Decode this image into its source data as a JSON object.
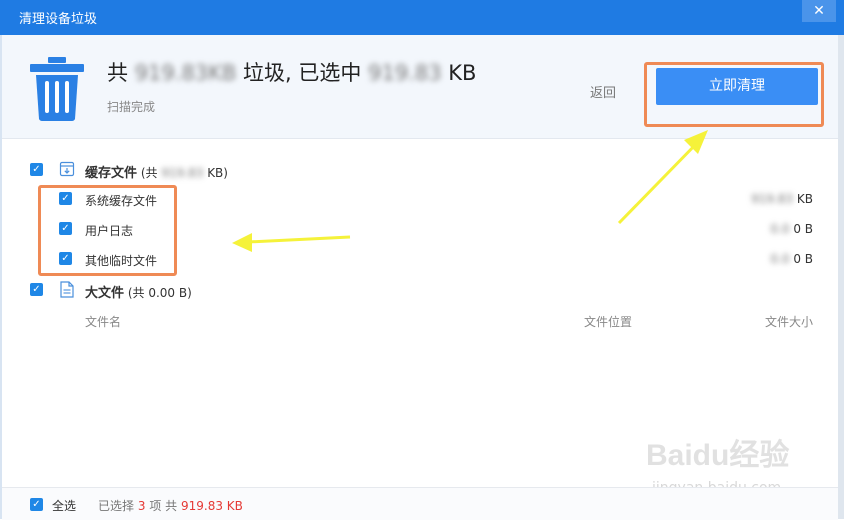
{
  "window": {
    "title": "清理设备垃圾",
    "close_glyph": "✕"
  },
  "header": {
    "summary_prefix": "共",
    "total_size_blurred": "919.83KB",
    "summary_middle": "垃圾, 已选中",
    "selected_size_blurred": "919.83",
    "selected_unit": "KB",
    "status": "扫描完成",
    "back_label": "返回",
    "clean_button_label": "立即清理"
  },
  "categories": {
    "cache": {
      "label": "缓存文件",
      "total_prefix": "(共",
      "total_blurred": "919.83",
      "total_suffix": "KB)",
      "items": [
        {
          "label": "系统缓存文件",
          "size_blurred": "919.83",
          "size_unit": "KB"
        },
        {
          "label": "用户日志",
          "size_blurred": "0.0",
          "size_unit": "0 B"
        },
        {
          "label": "其他临时文件",
          "size_blurred": "0.0",
          "size_unit": "0 B"
        }
      ]
    },
    "large_files": {
      "label": "大文件",
      "total": "(共 0.00 B)",
      "columns": [
        "文件名",
        "文件位置",
        "文件大小"
      ]
    }
  },
  "footer": {
    "select_all_label": "全选",
    "selected_prefix": "已选择",
    "selected_count": "3",
    "selected_middle": "项 共",
    "selected_total": "919.83 KB"
  },
  "watermark": {
    "main": "Baidu经验",
    "sub": "jingyan.baidu.com"
  },
  "colors": {
    "accent": "#1f7be3",
    "button": "#3a8ef5",
    "highlight": "#ef8a55",
    "arrow": "#f5f23a",
    "danger": "#e53935"
  },
  "icons": {
    "trash": "trash-icon",
    "cache": "download-box-icon",
    "large_files": "document-icon",
    "check": "checkmark-icon"
  }
}
